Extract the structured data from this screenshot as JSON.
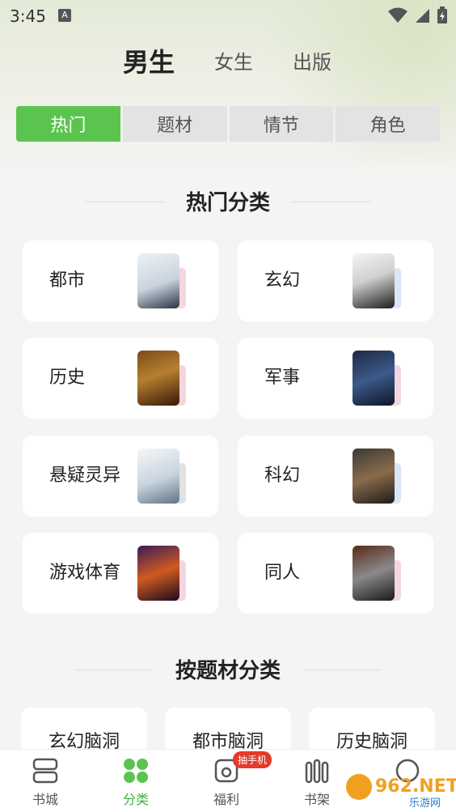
{
  "status_bar": {
    "time": "3:45",
    "notif_letter": "A"
  },
  "gender_tabs": [
    {
      "label": "男生",
      "active": true
    },
    {
      "label": "女生",
      "active": false
    },
    {
      "label": "出版",
      "active": false
    }
  ],
  "segment_tabs": [
    {
      "label": "热门",
      "active": true
    },
    {
      "label": "题材",
      "active": false
    },
    {
      "label": "情节",
      "active": false
    },
    {
      "label": "角色",
      "active": false
    }
  ],
  "hot_section": {
    "title": "热门分类"
  },
  "categories": [
    {
      "label": "都市",
      "accent": "#f5d6e0"
    },
    {
      "label": "玄幻",
      "accent": "#d9e6f5"
    },
    {
      "label": "历史",
      "accent": "#f5d6e0"
    },
    {
      "label": "军事",
      "accent": "#f5d6e0"
    },
    {
      "label": "悬疑灵异",
      "accent": "#e2e2e2"
    },
    {
      "label": "科幻",
      "accent": "#d9e6f5"
    },
    {
      "label": "游戏体育",
      "accent": "#f5d6e0"
    },
    {
      "label": "同人",
      "accent": "#f5d6e0"
    }
  ],
  "theme_section": {
    "title": "按题材分类"
  },
  "themes": [
    {
      "label": "玄幻脑洞"
    },
    {
      "label": "都市脑洞"
    },
    {
      "label": "历史脑洞"
    }
  ],
  "bottom_nav": [
    {
      "label": "书城",
      "icon": "bookstore-icon",
      "active": false
    },
    {
      "label": "分类",
      "icon": "category-icon",
      "active": true
    },
    {
      "label": "福利",
      "icon": "welfare-icon",
      "active": false,
      "badge": "抽手机"
    },
    {
      "label": "书架",
      "icon": "bookshelf-icon",
      "active": false
    },
    {
      "label": "",
      "icon": "profile-icon",
      "active": false
    }
  ],
  "watermark": {
    "text": "962.NET",
    "sub": "乐游网"
  },
  "colors": {
    "accent_green": "#5bc44f",
    "badge_red": "#e23b2b"
  }
}
